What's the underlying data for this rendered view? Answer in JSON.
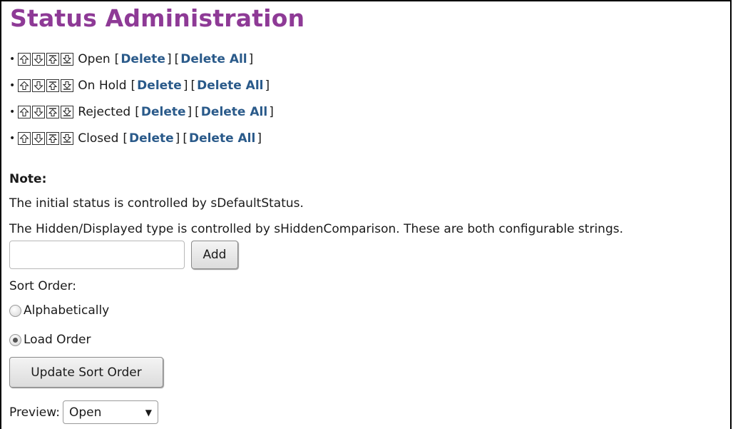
{
  "page": {
    "title": "Status Administration"
  },
  "statuses": [
    {
      "label": "Open"
    },
    {
      "label": "On Hold"
    },
    {
      "label": "Rejected"
    },
    {
      "label": "Closed"
    }
  ],
  "actions": {
    "delete": "Delete",
    "delete_all": "Delete All",
    "open_bracket": "[",
    "close_bracket": "]"
  },
  "bullet": "•",
  "note": {
    "title": "Note:",
    "line1": "The initial status is controlled by sDefaultStatus.",
    "line2": "The Hidden/Displayed type is controlled by sHiddenComparison. These are both configurable strings."
  },
  "add": {
    "input_value": "",
    "button_label": "Add"
  },
  "sort": {
    "label": "Sort Order:",
    "options": [
      {
        "label": "Alphabetically",
        "checked": false
      },
      {
        "label": "Load Order",
        "checked": true
      }
    ],
    "update_button": "Update Sort Order"
  },
  "preview": {
    "label": "Preview:",
    "selected": "Open",
    "caret": "▼"
  },
  "colors": {
    "title": "#8e3a96",
    "link": "#2a5a8a"
  },
  "icons": [
    "move-top-icon",
    "move-up-icon",
    "move-down-icon",
    "move-bottom-icon"
  ]
}
